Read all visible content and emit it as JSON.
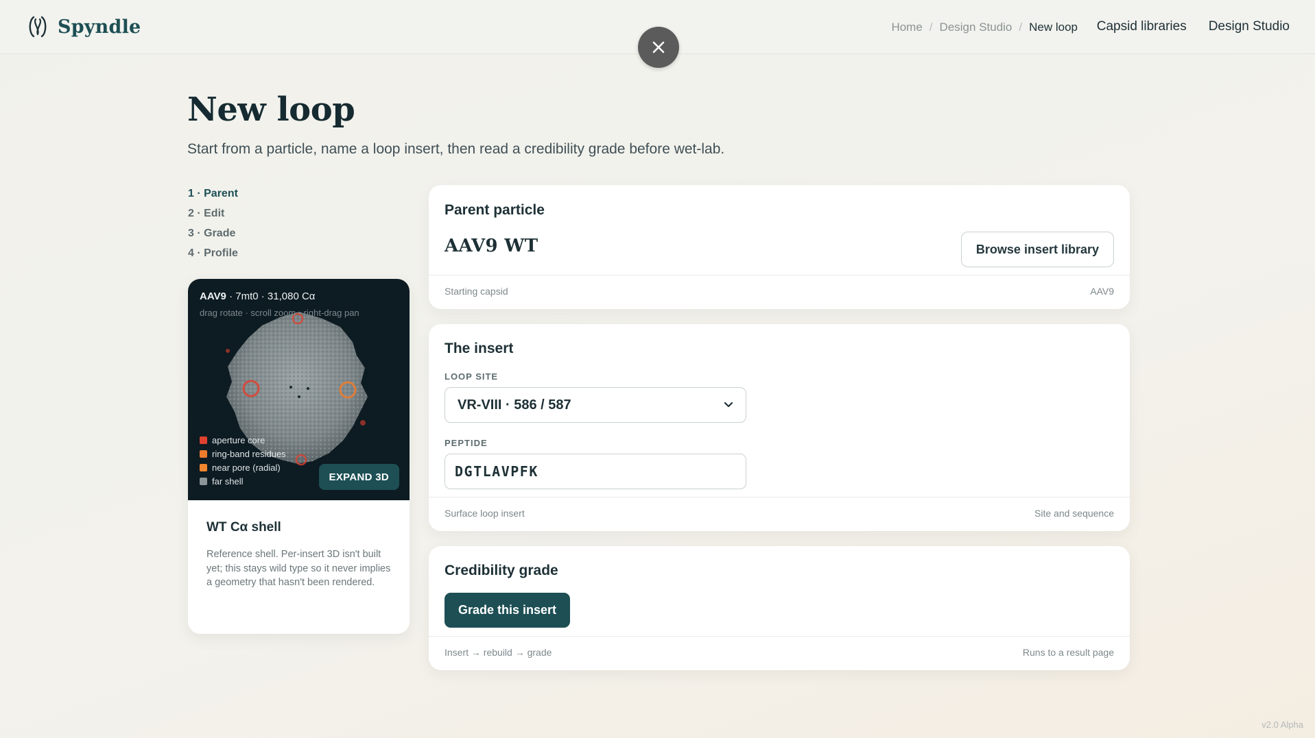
{
  "brand": {
    "name": "Spyndle",
    "logo_icon": "spyndle-logo-icon"
  },
  "breadcrumb": [
    {
      "label": "Home"
    },
    {
      "label": "Design Studio"
    },
    {
      "label": "New loop"
    }
  ],
  "nav": {
    "capsid": "Capsid libraries",
    "studio": "Design Studio"
  },
  "close": {
    "icon": "close-icon"
  },
  "page": {
    "title": "New loop",
    "subtitle": "Start from a particle, name a loop insert, then read a credibility grade before wet-lab."
  },
  "steps": [
    "1 · Parent",
    "2 · Edit",
    "3 · Grade",
    "4 · Profile"
  ],
  "viewer": {
    "title_bold": "AAV9",
    "title_rest": " · 7mt0 · 31,080 Cα",
    "hint": "drag rotate · scroll zoom · right-drag pan",
    "legend": [
      {
        "label": "aperture core",
        "color": "#e0412f"
      },
      {
        "label": "ring-band residues",
        "color": "#ef7b2c"
      },
      {
        "label": "near pore (radial)",
        "color": "#f0862e"
      },
      {
        "label": "far shell",
        "color": "#8b9497"
      }
    ],
    "expand_label": "EXPAND 3D",
    "caption": "WT Cα shell",
    "description": "Reference shell. Per-insert 3D isn't built yet; this stays wild type so it never implies a geometry that hasn't been rendered."
  },
  "parent_panel": {
    "heading": "Parent particle",
    "name": "AAV9 WT",
    "browse_label": "Browse insert library",
    "foot_left": "Starting capsid",
    "foot_right": "AAV9"
  },
  "insert_panel": {
    "heading": "The insert",
    "loop_site_label": "LOOP SITE",
    "loop_site_value": "VR-VIII · 586 / 587",
    "peptide_label": "PEPTIDE",
    "peptide_value": "DGTLAVPFK",
    "foot_left": "Surface loop insert",
    "foot_right": "Site and sequence"
  },
  "grade_panel": {
    "heading": "Credibility grade",
    "button_label": "Grade this insert",
    "foot_left": "Insert → rebuild → grade",
    "foot_right": "Runs to a result page"
  },
  "version": "v2.0 Alpha",
  "colors": {
    "brand": "#1d4f54",
    "viewer_bg": "#0d1b22"
  }
}
